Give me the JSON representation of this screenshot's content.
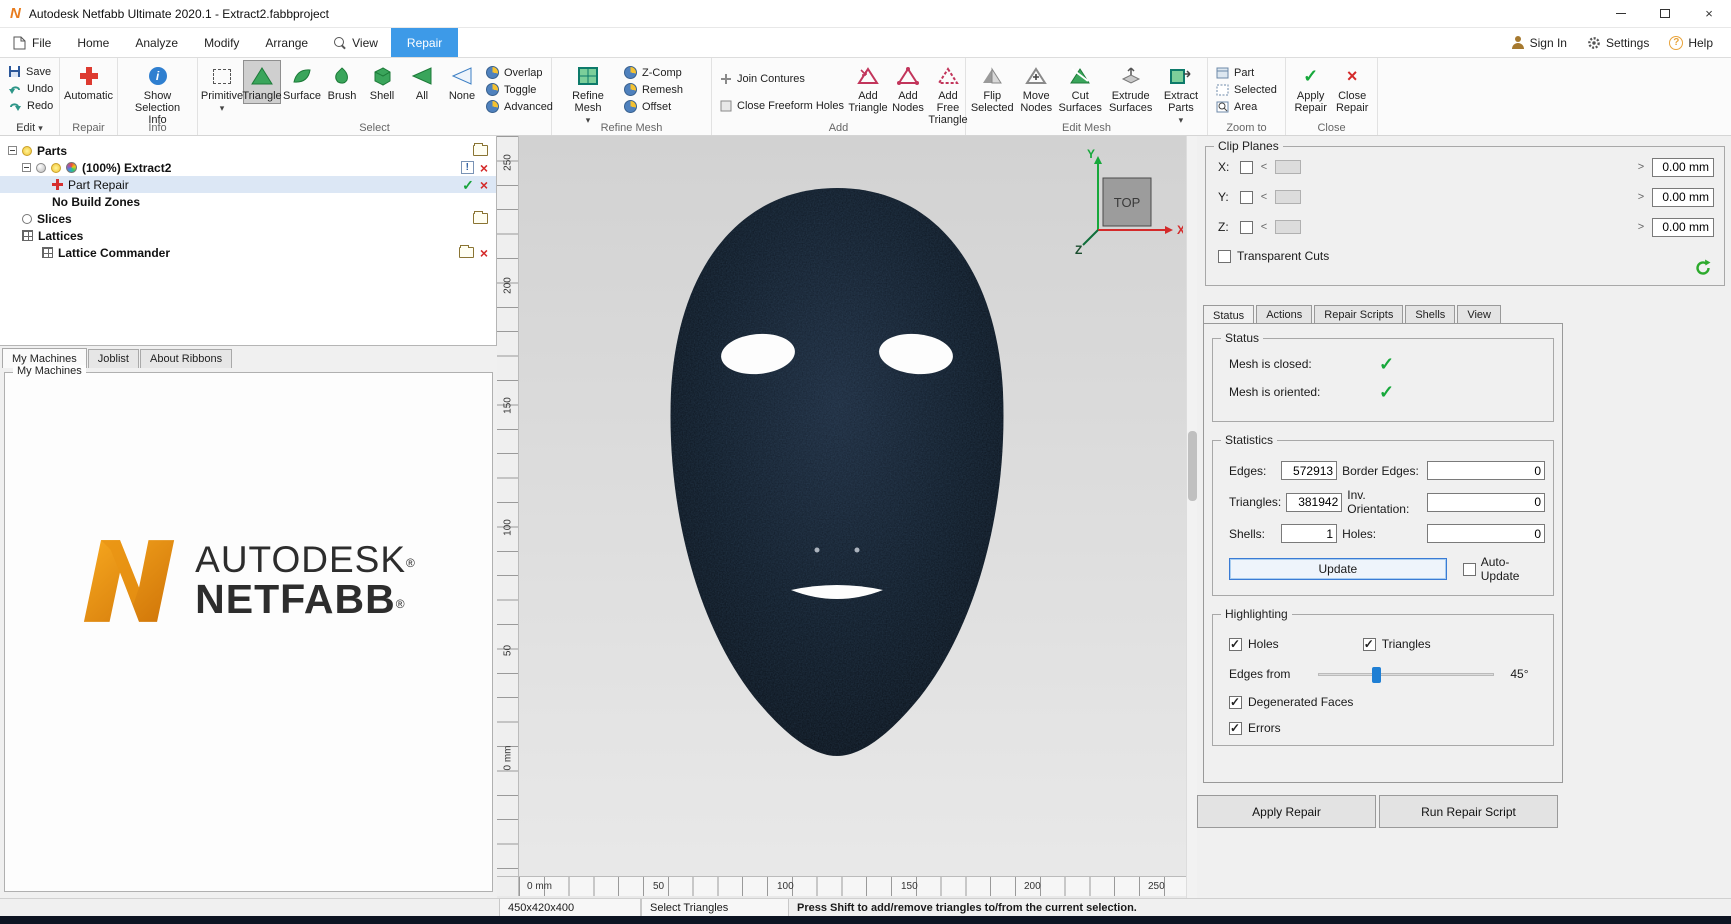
{
  "window": {
    "title": "Autodesk Netfabb Ultimate 2020.1  -  Extract2.fabbproject"
  },
  "icons": {
    "check": "✓",
    "cross": "×",
    "warning": "!",
    "chevron_left": "<",
    "chevron_right": ">",
    "dropdown": "▾",
    "question": "?",
    "logo_letter": "N"
  },
  "menubar": {
    "file": "File",
    "home": "Home",
    "analyze": "Analyze",
    "modify": "Modify",
    "arrange": "Arrange",
    "view": "View",
    "repair": "Repair",
    "sign_in": "Sign In",
    "settings": "Settings",
    "help": "Help"
  },
  "ribbon": {
    "edit": {
      "save": "Save",
      "undo": "Undo",
      "redo": "Redo",
      "menu": "Edit"
    },
    "repair": {
      "automatic": "Automatic",
      "label": "Repair"
    },
    "info": {
      "show_selection_info": "Show Selection Info",
      "label": "Info"
    },
    "select": {
      "primitive": "Primitive",
      "triangle": "Triangle",
      "surface": "Surface",
      "brush": "Brush",
      "shell": "Shell",
      "all": "All",
      "none": "None",
      "overlap": "Overlap",
      "toggle": "Toggle",
      "advanced": "Advanced",
      "label": "Select"
    },
    "refine": {
      "refine_mesh": "Refine Mesh",
      "z_comp": "Z-Comp",
      "remesh": "Remesh",
      "offset": "Offset",
      "label": "Refine Mesh"
    },
    "add": {
      "join_contures": "Join Contures",
      "close_freeform": "Close Freeform Holes",
      "add_triangle": "Add Triangle",
      "add_nodes": "Add Nodes",
      "add_free_triangle": "Add Free Triangle",
      "label": "Add"
    },
    "edit_mesh": {
      "flip_selected": "Flip Selected",
      "move_nodes": "Move Nodes",
      "cut_surfaces": "Cut Surfaces",
      "extrude_surfaces": "Extrude Surfaces",
      "extract_parts": "Extract Parts",
      "label": "Edit Mesh"
    },
    "zoom": {
      "part": "Part",
      "selected": "Selected",
      "area": "Area",
      "label": "Zoom to"
    },
    "close": {
      "apply_repair": "Apply Repair",
      "close_repair": "Close Repair",
      "label": "Close"
    }
  },
  "tree": {
    "parts": "Parts",
    "extract": "(100%) Extract2",
    "part_repair": "Part Repair",
    "no_build_zones": "No Build Zones",
    "slices": "Slices",
    "lattices": "Lattices",
    "lattice_commander": "Lattice Commander"
  },
  "left_tabs": {
    "my_machines": "My Machines",
    "joblist": "Joblist",
    "about_ribbons": "About Ribbons"
  },
  "machines": {
    "group_label": "My Machines",
    "brand_top": "AUTODESK",
    "brand_bottom": "NETFABB",
    "reg": "®"
  },
  "viewport": {
    "v_ruler": [
      "250",
      "200",
      "150",
      "100",
      "50",
      "0 mm"
    ],
    "h_ruler": [
      "0 mm",
      "50",
      "100",
      "150",
      "200",
      "250"
    ],
    "cube": "TOP",
    "axis_x": "X",
    "axis_y": "Y",
    "axis_z": "Z"
  },
  "clip_planes": {
    "title": "Clip Planes",
    "x_label": "X:",
    "y_label": "Y:",
    "z_label": "Z:",
    "x_value": "0.00 mm",
    "y_value": "0.00 mm",
    "z_value": "0.00 mm",
    "transparent_cuts": "Transparent Cuts"
  },
  "panel_tabs": {
    "status": "Status",
    "actions": "Actions",
    "repair_scripts": "Repair Scripts",
    "shells": "Shells",
    "view": "View"
  },
  "status_group": {
    "title": "Status",
    "closed": "Mesh is closed:",
    "oriented": "Mesh is oriented:"
  },
  "statistics": {
    "title": "Statistics",
    "edges_label": "Edges:",
    "edges_value": "572913",
    "border_label": "Border Edges:",
    "border_value": "0",
    "triangles_label": "Triangles:",
    "triangles_value": "381942",
    "inv_label": "Inv. Orientation:",
    "inv_value": "0",
    "shells_label": "Shells:",
    "shells_value": "1",
    "holes_label": "Holes:",
    "holes_value": "0",
    "update": "Update",
    "auto_update": "Auto-Update"
  },
  "highlighting": {
    "title": "Highlighting",
    "holes": "Holes",
    "triangles": "Triangles",
    "edges_from": "Edges from",
    "angle": "45°",
    "degenerated_faces": "Degenerated Faces",
    "errors": "Errors"
  },
  "footer": {
    "apply_repair": "Apply Repair",
    "run_repair_script": "Run Repair Script"
  },
  "statusbar": {
    "dimensions": "450x420x400",
    "mode": "Select Triangles",
    "hint": "Press Shift to add/remove triangles to/from the current selection."
  }
}
